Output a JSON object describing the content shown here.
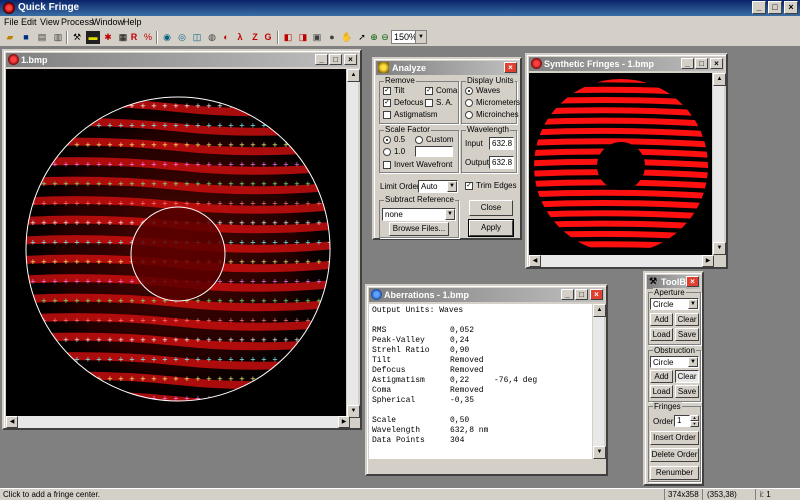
{
  "app": {
    "title": "Quick Fringe"
  },
  "menu": [
    "File",
    "Edit",
    "View",
    "Process",
    "Window",
    "Help"
  ],
  "toolbar": {
    "zoom": "150%"
  },
  "status": {
    "hint": "Click to add a fringe center.",
    "size": "374x358",
    "coords": "(353,38)",
    "index": "i: 1"
  },
  "image_window": {
    "title": "1.bmp"
  },
  "synthetic_window": {
    "title": "Synthetic Fringes - 1.bmp"
  },
  "analyze": {
    "title": "Analyze",
    "remove_label": "Remove",
    "tilt": "Tilt",
    "coma": "Coma",
    "defocus": "Defocus",
    "sa": "S. A.",
    "astig": "Astigmatism",
    "display_units_label": "Display Units",
    "waves": "Waves",
    "micrometers": "Micrometers",
    "microinches": "Microinches",
    "scale_factor_label": "Scale Factor",
    "s05": "0.5",
    "s10": "1.0",
    "custom": "Custom",
    "invert": "Invert Wavefront",
    "wavelength_label": "Wavelength",
    "input_label": "Input",
    "input_value": "632.8",
    "output_label": "Output",
    "output_value": "632.8",
    "limit_order_label": "Limit Order",
    "limit_order_value": "Auto",
    "trim_edges": "Trim Edges",
    "subtract_label": "Subtract Reference",
    "subtract_value": "none",
    "browse": "Browse Files...",
    "close": "Close",
    "apply": "Apply"
  },
  "aberrations": {
    "title": "Aberrations - 1.bmp",
    "header": "Output Units: Waves",
    "rows": [
      {
        "k": "RMS",
        "v": "0,052",
        "x": ""
      },
      {
        "k": "Peak-Valley",
        "v": "0,24",
        "x": ""
      },
      {
        "k": "Strehl Ratio",
        "v": "0,90",
        "x": ""
      },
      {
        "k": "Tilt",
        "v": "Removed",
        "x": ""
      },
      {
        "k": "Defocus",
        "v": "Removed",
        "x": ""
      },
      {
        "k": "Astigmatism",
        "v": "0,22",
        "x": "-76,4 deg"
      },
      {
        "k": "Coma",
        "v": "Removed",
        "x": ""
      },
      {
        "k": "Spherical",
        "v": "-0,35",
        "x": ""
      }
    ],
    "rows2": [
      {
        "k": "Scale",
        "v": "0,50"
      },
      {
        "k": "Wavelength",
        "v": "632,8 nm"
      },
      {
        "k": "Data Points",
        "v": "304"
      }
    ]
  },
  "toolbox": {
    "title": "ToolBox",
    "aperture_label": "Aperture",
    "aperture_shape": "Circle",
    "obstruction_label": "Obstruction",
    "obstruction_shape": "Circle",
    "add": "Add",
    "clear": "Clear",
    "load": "Load",
    "save": "Save",
    "fringes_label": "Fringes",
    "order_label": "Order",
    "order_value": "1",
    "insert_order": "Insert Order",
    "delete_order": "Delete Order",
    "renumber": "Renumber"
  },
  "colors": {
    "fringe": "#e01010",
    "titlebar_active": "#0a246a",
    "window_face": "#d4d0c8"
  }
}
